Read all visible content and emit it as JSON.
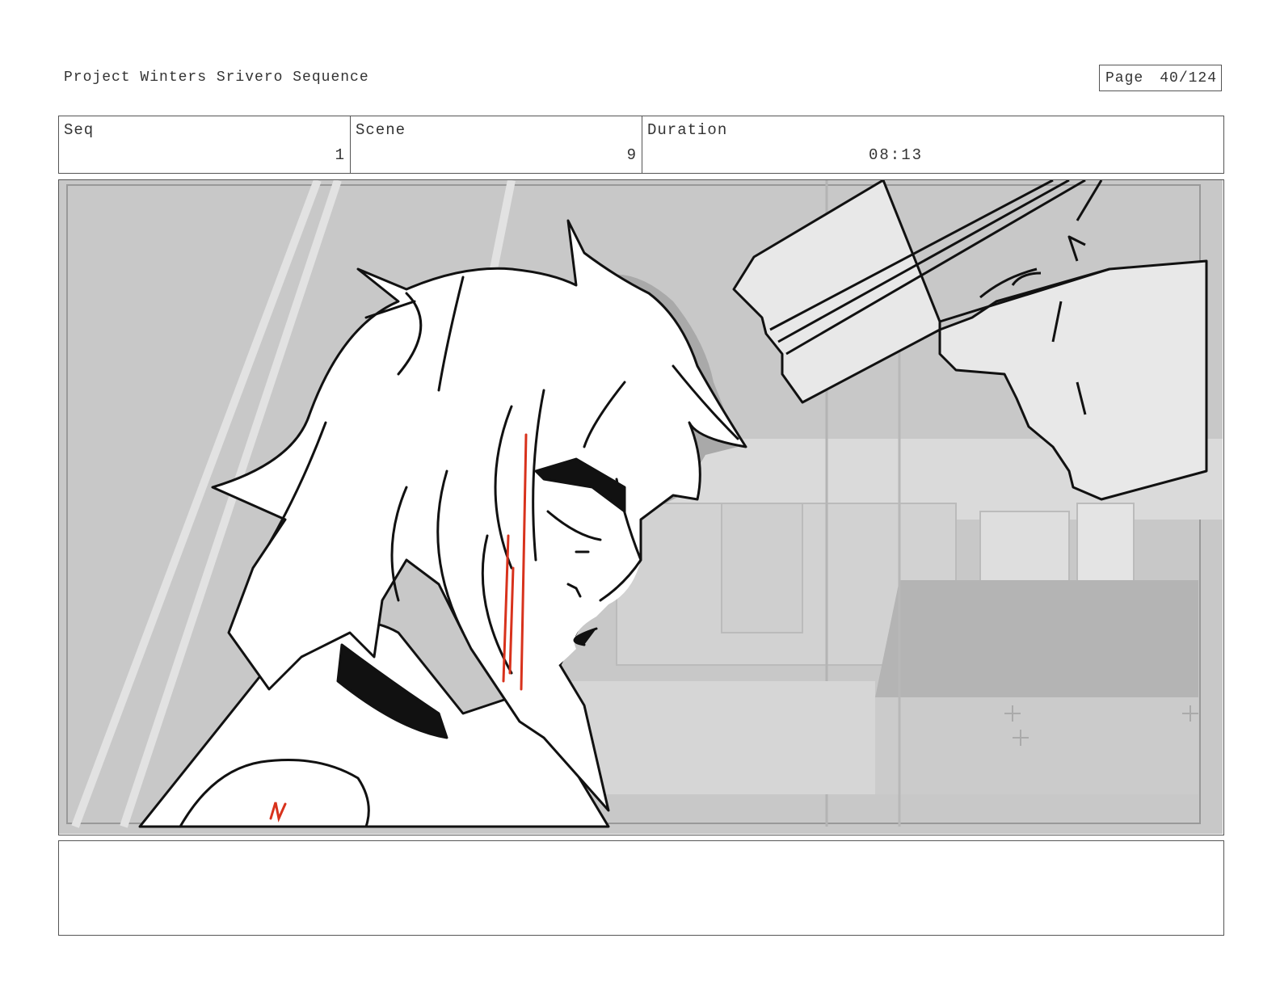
{
  "header": {
    "project_title": "Project Winters Srivero Sequence",
    "page_label": "Page",
    "page_number": "40/124"
  },
  "info": {
    "seq_label": "Seq",
    "seq_value": "1",
    "scene_label": "Scene",
    "scene_value": "9",
    "duration_label": "Duration",
    "duration_value": "08:13"
  },
  "panel": {
    "colors": {
      "background": "#c8c8c8",
      "line": "#111111",
      "accent_red": "#d8321c",
      "shadow": "#a9a9a9"
    }
  },
  "notes": {
    "text": ""
  }
}
